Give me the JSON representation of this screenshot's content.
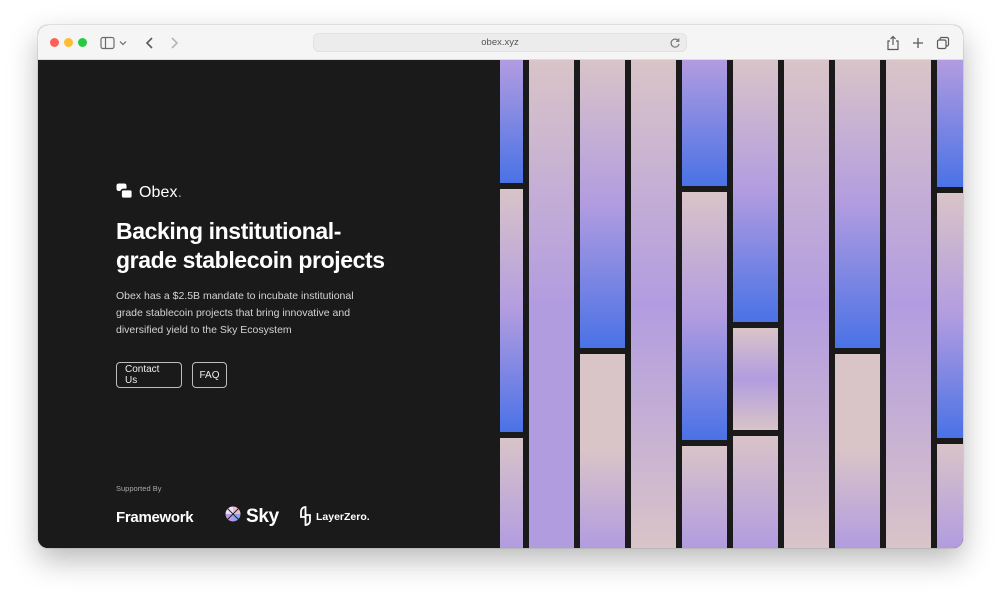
{
  "browser": {
    "url": "obex.xyz"
  },
  "page": {
    "logo_text": "Obex",
    "logo_suffix": ".",
    "headline": "Backing institutional-grade stablecoin projects",
    "description": "Obex has a $2.5B mandate to incubate institutional grade stablecoin projects that bring innovative and diversified yield to the Sky Ecosystem",
    "buttons": {
      "contact": "Contact Us",
      "faq": "FAQ"
    },
    "supported_by": {
      "label": "Supported By",
      "partners": [
        "Framework",
        "Sky",
        "LayerZero."
      ]
    }
  },
  "colors": {
    "background": "#1a1a1a",
    "text": "#ffffff",
    "muted_text": "#d3d3d3",
    "stripe_pink": "#d9c4c8",
    "stripe_lavender": "#b29ce0",
    "stripe_blue": "#4a72e6"
  },
  "icons": [
    "sidebar-icon",
    "chevron-left-icon",
    "chevron-right-icon",
    "reload-icon",
    "share-icon",
    "plus-icon",
    "tabs-icon"
  ]
}
